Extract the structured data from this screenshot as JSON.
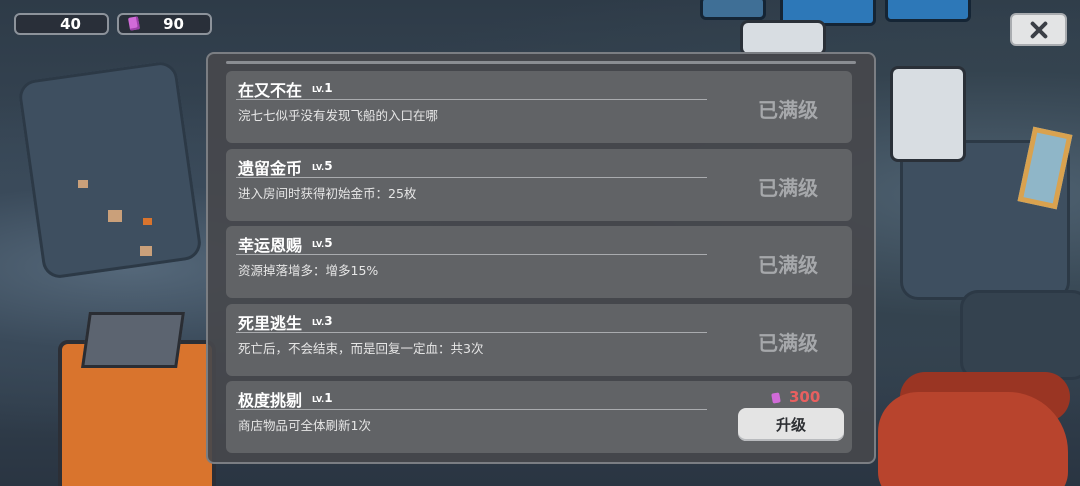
{
  "colors": {
    "panel_bg": "#46484c",
    "card_bg": "#616366",
    "maxed_text": "#a6a8ab",
    "cost_text": "#e86060",
    "gem": "#d16bd8"
  },
  "hud": {
    "diamond": {
      "icon": "diamond-icon",
      "value": "40"
    },
    "gem": {
      "icon": "gem-icon",
      "value": "90"
    },
    "close": {
      "icon": "close-icon"
    }
  },
  "upgrades": [
    {
      "title": "在又不在",
      "level_prefix": "LV.",
      "level": "1",
      "description": "浣七七似乎没有发现飞船的入口在哪",
      "status": "已满级"
    },
    {
      "title": "遗留金币",
      "level_prefix": "LV.",
      "level": "5",
      "description": "进入房间时获得初始金币：25枚",
      "status": "已满级"
    },
    {
      "title": "幸运恩赐",
      "level_prefix": "LV.",
      "level": "5",
      "description": "资源掉落增多：增多15%",
      "status": "已满级"
    },
    {
      "title": "死里逃生",
      "level_prefix": "LV.",
      "level": "3",
      "description": "死亡后，不会结束，而是回复一定血：共3次",
      "status": "已满级"
    },
    {
      "title": "极度挑剔",
      "level_prefix": "LV.",
      "level": "1",
      "description": "商店物品可全体刷新1次",
      "cost": "300",
      "cost_icon": "gem-icon",
      "button_label": "升级"
    }
  ]
}
